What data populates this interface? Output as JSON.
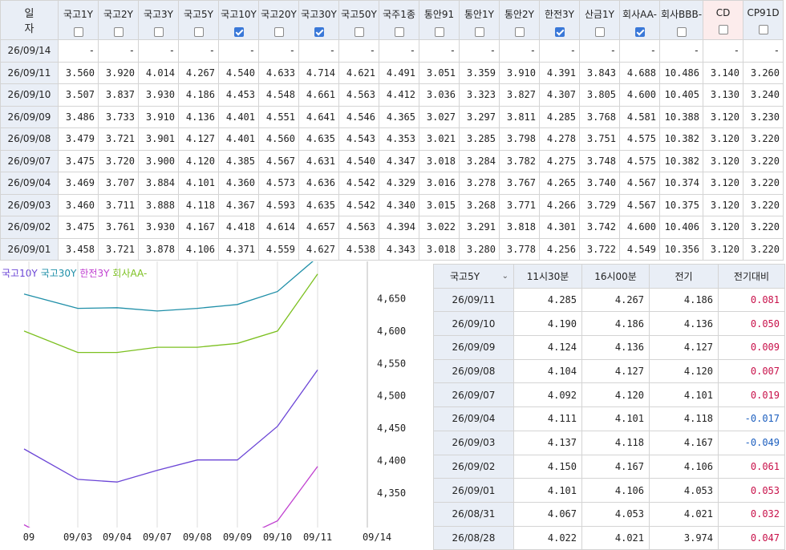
{
  "rates_table": {
    "date_header": "일 자",
    "columns": [
      {
        "label": "국고1Y",
        "checked": false
      },
      {
        "label": "국고2Y",
        "checked": false
      },
      {
        "label": "국고3Y",
        "checked": false
      },
      {
        "label": "국고5Y",
        "checked": false
      },
      {
        "label": "국고10Y",
        "checked": true
      },
      {
        "label": "국고20Y",
        "checked": false
      },
      {
        "label": "국고30Y",
        "checked": true
      },
      {
        "label": "국고50Y",
        "checked": false
      },
      {
        "label": "국주1종",
        "checked": false
      },
      {
        "label": "통안91",
        "checked": false
      },
      {
        "label": "통안1Y",
        "checked": false
      },
      {
        "label": "통안2Y",
        "checked": false
      },
      {
        "label": "한전3Y",
        "checked": true
      },
      {
        "label": "산금1Y",
        "checked": false
      },
      {
        "label": "회사AA-",
        "checked": true
      },
      {
        "label": "회사BBB-",
        "checked": false
      },
      {
        "label": "CD",
        "checked": false
      },
      {
        "label": "CP91D",
        "checked": false
      }
    ],
    "rows": [
      {
        "date": "26/09/14",
        "values": [
          "-",
          "-",
          "-",
          "-",
          "-",
          "-",
          "-",
          "-",
          "-",
          "-",
          "-",
          "-",
          "-",
          "-",
          "-",
          "-",
          "-",
          "-"
        ]
      },
      {
        "date": "26/09/11",
        "values": [
          "3.560",
          "3.920",
          "4.014",
          "4.267",
          "4.540",
          "4.633",
          "4.714",
          "4.621",
          "4.491",
          "3.051",
          "3.359",
          "3.910",
          "4.391",
          "3.843",
          "4.688",
          "10.486",
          "3.140",
          "3.260"
        ]
      },
      {
        "date": "26/09/10",
        "values": [
          "3.507",
          "3.837",
          "3.930",
          "4.186",
          "4.453",
          "4.548",
          "4.661",
          "4.563",
          "4.412",
          "3.036",
          "3.323",
          "3.827",
          "4.307",
          "3.805",
          "4.600",
          "10.405",
          "3.130",
          "3.240"
        ]
      },
      {
        "date": "26/09/09",
        "values": [
          "3.486",
          "3.733",
          "3.910",
          "4.136",
          "4.401",
          "4.551",
          "4.641",
          "4.546",
          "4.365",
          "3.027",
          "3.297",
          "3.811",
          "4.285",
          "3.768",
          "4.581",
          "10.388",
          "3.120",
          "3.230"
        ]
      },
      {
        "date": "26/09/08",
        "values": [
          "3.479",
          "3.721",
          "3.901",
          "4.127",
          "4.401",
          "4.560",
          "4.635",
          "4.543",
          "4.353",
          "3.021",
          "3.285",
          "3.798",
          "4.278",
          "3.751",
          "4.575",
          "10.382",
          "3.120",
          "3.220"
        ]
      },
      {
        "date": "26/09/07",
        "values": [
          "3.475",
          "3.720",
          "3.900",
          "4.120",
          "4.385",
          "4.567",
          "4.631",
          "4.540",
          "4.347",
          "3.018",
          "3.284",
          "3.782",
          "4.275",
          "3.748",
          "4.575",
          "10.382",
          "3.120",
          "3.220"
        ]
      },
      {
        "date": "26/09/04",
        "values": [
          "3.469",
          "3.707",
          "3.884",
          "4.101",
          "4.360",
          "4.573",
          "4.636",
          "4.542",
          "4.329",
          "3.016",
          "3.278",
          "3.767",
          "4.265",
          "3.740",
          "4.567",
          "10.374",
          "3.120",
          "3.220"
        ]
      },
      {
        "date": "26/09/03",
        "values": [
          "3.460",
          "3.711",
          "3.888",
          "4.118",
          "4.367",
          "4.593",
          "4.635",
          "4.542",
          "4.340",
          "3.015",
          "3.268",
          "3.771",
          "4.266",
          "3.729",
          "4.567",
          "10.375",
          "3.120",
          "3.220"
        ]
      },
      {
        "date": "26/09/02",
        "values": [
          "3.475",
          "3.761",
          "3.930",
          "4.167",
          "4.418",
          "4.614",
          "4.657",
          "4.563",
          "4.394",
          "3.022",
          "3.291",
          "3.818",
          "4.301",
          "3.742",
          "4.600",
          "10.406",
          "3.120",
          "3.220"
        ]
      },
      {
        "date": "26/09/01",
        "values": [
          "3.458",
          "3.721",
          "3.878",
          "4.106",
          "4.371",
          "4.559",
          "4.627",
          "4.538",
          "4.343",
          "3.018",
          "3.280",
          "3.778",
          "4.256",
          "3.722",
          "4.549",
          "10.356",
          "3.120",
          "3.220"
        ]
      }
    ]
  },
  "legend": [
    {
      "label": "국고10Y",
      "color": "#6b45d6"
    },
    {
      "label": "국고30Y",
      "color": "#1f8fa8"
    },
    {
      "label": "한전3Y",
      "color": "#c040d0"
    },
    {
      "label": "회사AA-",
      "color": "#7cc020"
    }
  ],
  "chart_data": {
    "type": "line",
    "x": [
      "09",
      "09/03",
      "09/04",
      "09/07",
      "09/08",
      "09/09",
      "09/10",
      "09/11",
      "09/14"
    ],
    "ylim": [
      4.3,
      4.68
    ],
    "y_ticks": [
      "4,650",
      "4,600",
      "4,550",
      "4,500",
      "4,450",
      "4,400",
      "4,350"
    ],
    "y_tick_values": [
      4.65,
      4.6,
      4.55,
      4.5,
      4.45,
      4.4,
      4.35
    ],
    "series": [
      {
        "name": "국고10Y",
        "color": "#6b45d6",
        "values": [
          4.418,
          4.371,
          4.367,
          4.385,
          4.401,
          4.401,
          4.453,
          4.54
        ]
      },
      {
        "name": "국고30Y",
        "color": "#1f8fa8",
        "values": [
          4.657,
          4.635,
          4.636,
          4.631,
          4.635,
          4.641,
          4.661,
          4.714
        ]
      },
      {
        "name": "한전3Y",
        "color": "#c040d0",
        "values": [
          4.301,
          4.256,
          4.266,
          4.265,
          4.275,
          4.278,
          4.307,
          4.391
        ]
      },
      {
        "name": "회사AA-",
        "color": "#7cc020",
        "values": [
          4.6,
          4.567,
          4.567,
          4.575,
          4.575,
          4.581,
          4.6,
          4.688
        ]
      }
    ]
  },
  "compare_table": {
    "headers": [
      "국고5Y",
      "11시30분",
      "16시00분",
      "전기",
      "전기대비"
    ],
    "rows": [
      {
        "date": "26/09/11",
        "v1": "4.285",
        "v2": "4.267",
        "v3": "4.186",
        "diff": "0.081"
      },
      {
        "date": "26/09/10",
        "v1": "4.190",
        "v2": "4.186",
        "v3": "4.136",
        "diff": "0.050"
      },
      {
        "date": "26/09/09",
        "v1": "4.124",
        "v2": "4.136",
        "v3": "4.127",
        "diff": "0.009"
      },
      {
        "date": "26/09/08",
        "v1": "4.104",
        "v2": "4.127",
        "v3": "4.120",
        "diff": "0.007"
      },
      {
        "date": "26/09/07",
        "v1": "4.092",
        "v2": "4.120",
        "v3": "4.101",
        "diff": "0.019"
      },
      {
        "date": "26/09/04",
        "v1": "4.111",
        "v2": "4.101",
        "v3": "4.118",
        "diff": "-0.017"
      },
      {
        "date": "26/09/03",
        "v1": "4.137",
        "v2": "4.118",
        "v3": "4.167",
        "diff": "-0.049"
      },
      {
        "date": "26/09/02",
        "v1": "4.150",
        "v2": "4.167",
        "v3": "4.106",
        "diff": "0.061"
      },
      {
        "date": "26/09/01",
        "v1": "4.101",
        "v2": "4.106",
        "v3": "4.053",
        "diff": "0.053"
      },
      {
        "date": "26/08/31",
        "v1": "4.067",
        "v2": "4.053",
        "v3": "4.021",
        "diff": "0.032"
      },
      {
        "date": "26/08/28",
        "v1": "4.022",
        "v2": "4.021",
        "v3": "3.974",
        "diff": "0.047"
      }
    ]
  }
}
